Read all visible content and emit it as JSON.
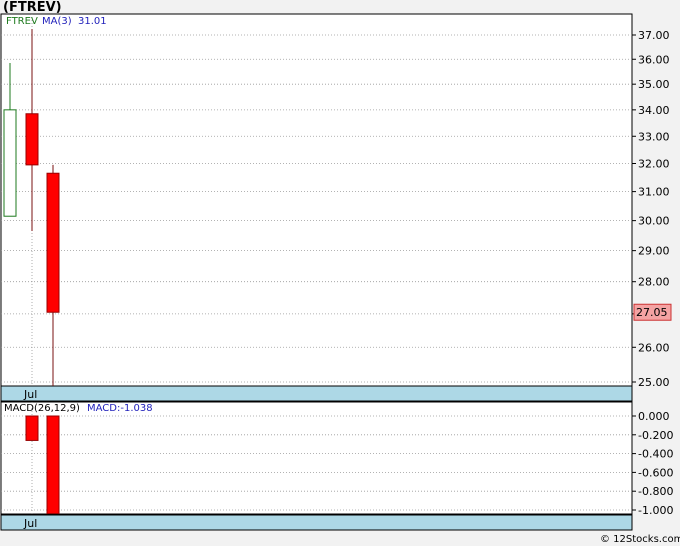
{
  "chart_data": [
    {
      "type": "candlestick",
      "title": "(FTREV)",
      "legend": [
        {
          "text": "FTREV",
          "color": "#1e7a1e"
        },
        {
          "text": "MA(3)",
          "color": "#2222bb"
        },
        {
          "text": "31.01",
          "color": "#2222bb"
        }
      ],
      "x_label": "Jul",
      "candles": [
        {
          "open": 30.15,
          "high": 35.85,
          "low": 30.15,
          "close": 34.0,
          "color": "#1e7a1e"
        },
        {
          "open": 33.85,
          "high": 37.25,
          "low": 29.65,
          "close": 31.95,
          "color": "#ff0000"
        },
        {
          "open": 31.65,
          "high": 31.95,
          "low": 24.8,
          "close": 27.05,
          "color": "#ff0000"
        }
      ],
      "last_value": "27.05",
      "ylim": [
        24.8,
        37.6
      ],
      "yticks": [
        "37.00",
        "36.00",
        "35.00",
        "34.00",
        "33.00",
        "32.00",
        "31.00",
        "30.00",
        "29.00",
        "28.00",
        "27.00",
        "26.00",
        "25.00"
      ],
      "y_scale": "log",
      "grid": true
    },
    {
      "type": "bar",
      "legend": [
        {
          "text": "MACD(26,12,9)",
          "color": "#000000"
        },
        {
          "text": "MACD:-1.038",
          "color": "#2222bb"
        }
      ],
      "x_label": "Jul",
      "values": [
        null,
        -0.26,
        -1.038
      ],
      "ylim": [
        -1.0,
        0.0
      ],
      "yticks": [
        "0.000",
        "-0.200",
        "-0.400",
        "-0.600",
        "-0.800",
        "-1.000"
      ],
      "grid": true
    }
  ],
  "footer": {
    "copyright": "© 12Stocks.com"
  }
}
